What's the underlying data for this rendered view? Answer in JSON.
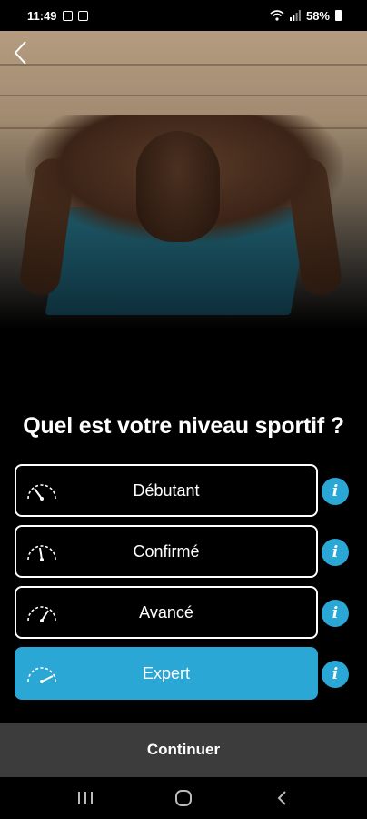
{
  "status_bar": {
    "time": "11:49",
    "battery": "58%",
    "icons": [
      "gallery-icon",
      "notification-icon",
      "wifi-icon",
      "signal-icon",
      "battery-icon"
    ]
  },
  "header": {
    "back_icon": "chevron-left-icon"
  },
  "question": "Quel est votre niveau sportif ?",
  "levels": [
    {
      "label": "Débutant",
      "icon": "gauge-low-icon",
      "selected": false
    },
    {
      "label": "Confirmé",
      "icon": "gauge-mid-icon",
      "selected": false
    },
    {
      "label": "Avancé",
      "icon": "gauge-high-icon",
      "selected": false
    },
    {
      "label": "Expert",
      "icon": "gauge-max-icon",
      "selected": true
    }
  ],
  "info_icon": "info-icon",
  "continue_label": "Continuer",
  "nav": [
    "recent-apps-icon",
    "home-icon",
    "back-icon"
  ],
  "colors": {
    "accent": "#2ba7d6",
    "background": "#000000",
    "continue_bar": "#3c3c3c"
  }
}
